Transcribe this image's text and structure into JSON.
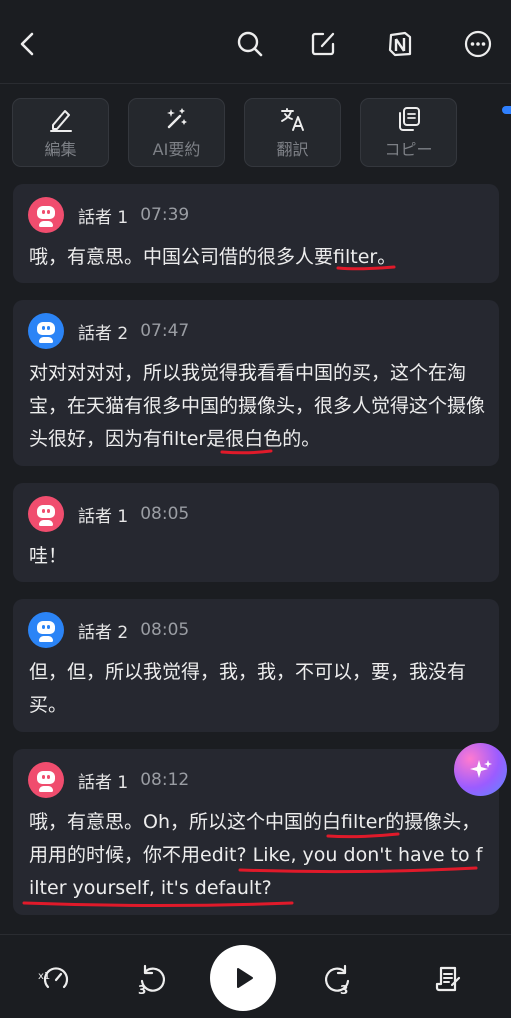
{
  "toolbar": {
    "back_icon": "chevron-left-icon",
    "search_icon": "search-icon",
    "edit_icon": "external-edit-icon",
    "notion_icon": "notion-icon",
    "more_icon": "more-icon"
  },
  "actions": [
    {
      "label": "編集",
      "icon": "pencil-icon"
    },
    {
      "label": "AI要約",
      "icon": "magic-wand-icon"
    },
    {
      "label": "翻訳",
      "icon": "translate-icon"
    },
    {
      "label": "コピー",
      "icon": "copy-icon"
    }
  ],
  "messages": [
    {
      "speaker": "話者 1",
      "time": "07:39",
      "text": "哦，有意思。中国公司借的很多人要filter。",
      "avatar_color": "#f04d6e"
    },
    {
      "speaker": "話者 2",
      "time": "07:47",
      "text": "对对对对对，所以我觉得我看看中国的买，这个在淘宝，在天猫有很多中国的摄像头，很多人觉得这个摄像头很好，因为有filter是很白色的。",
      "avatar_color": "#2b84f6"
    },
    {
      "speaker": "話者 1",
      "time": "08:05",
      "text": "哇！",
      "avatar_color": "#f04d6e"
    },
    {
      "speaker": "話者 2",
      "time": "08:05",
      "text": "但，但，所以我觉得，我，我，不可以，要，我没有买。",
      "avatar_color": "#2b84f6"
    },
    {
      "speaker": "話者 1",
      "time": "08:12",
      "text": "哦，有意思。Oh，所以这个中国的白filter的摄像头，用用的时候，你不用edit? Like, you don't have to filter yourself, it's default?",
      "avatar_color": "#f04d6e"
    }
  ],
  "player": {
    "speed_label": "x1",
    "skip_back_label": "3",
    "skip_forward_label": "3",
    "transcript_icon": "transcript-icon"
  },
  "colors": {
    "background": "#1b1d21",
    "card": "#262830",
    "accent_blue": "#2f80ff",
    "annotation_red": "#e01a2a"
  }
}
